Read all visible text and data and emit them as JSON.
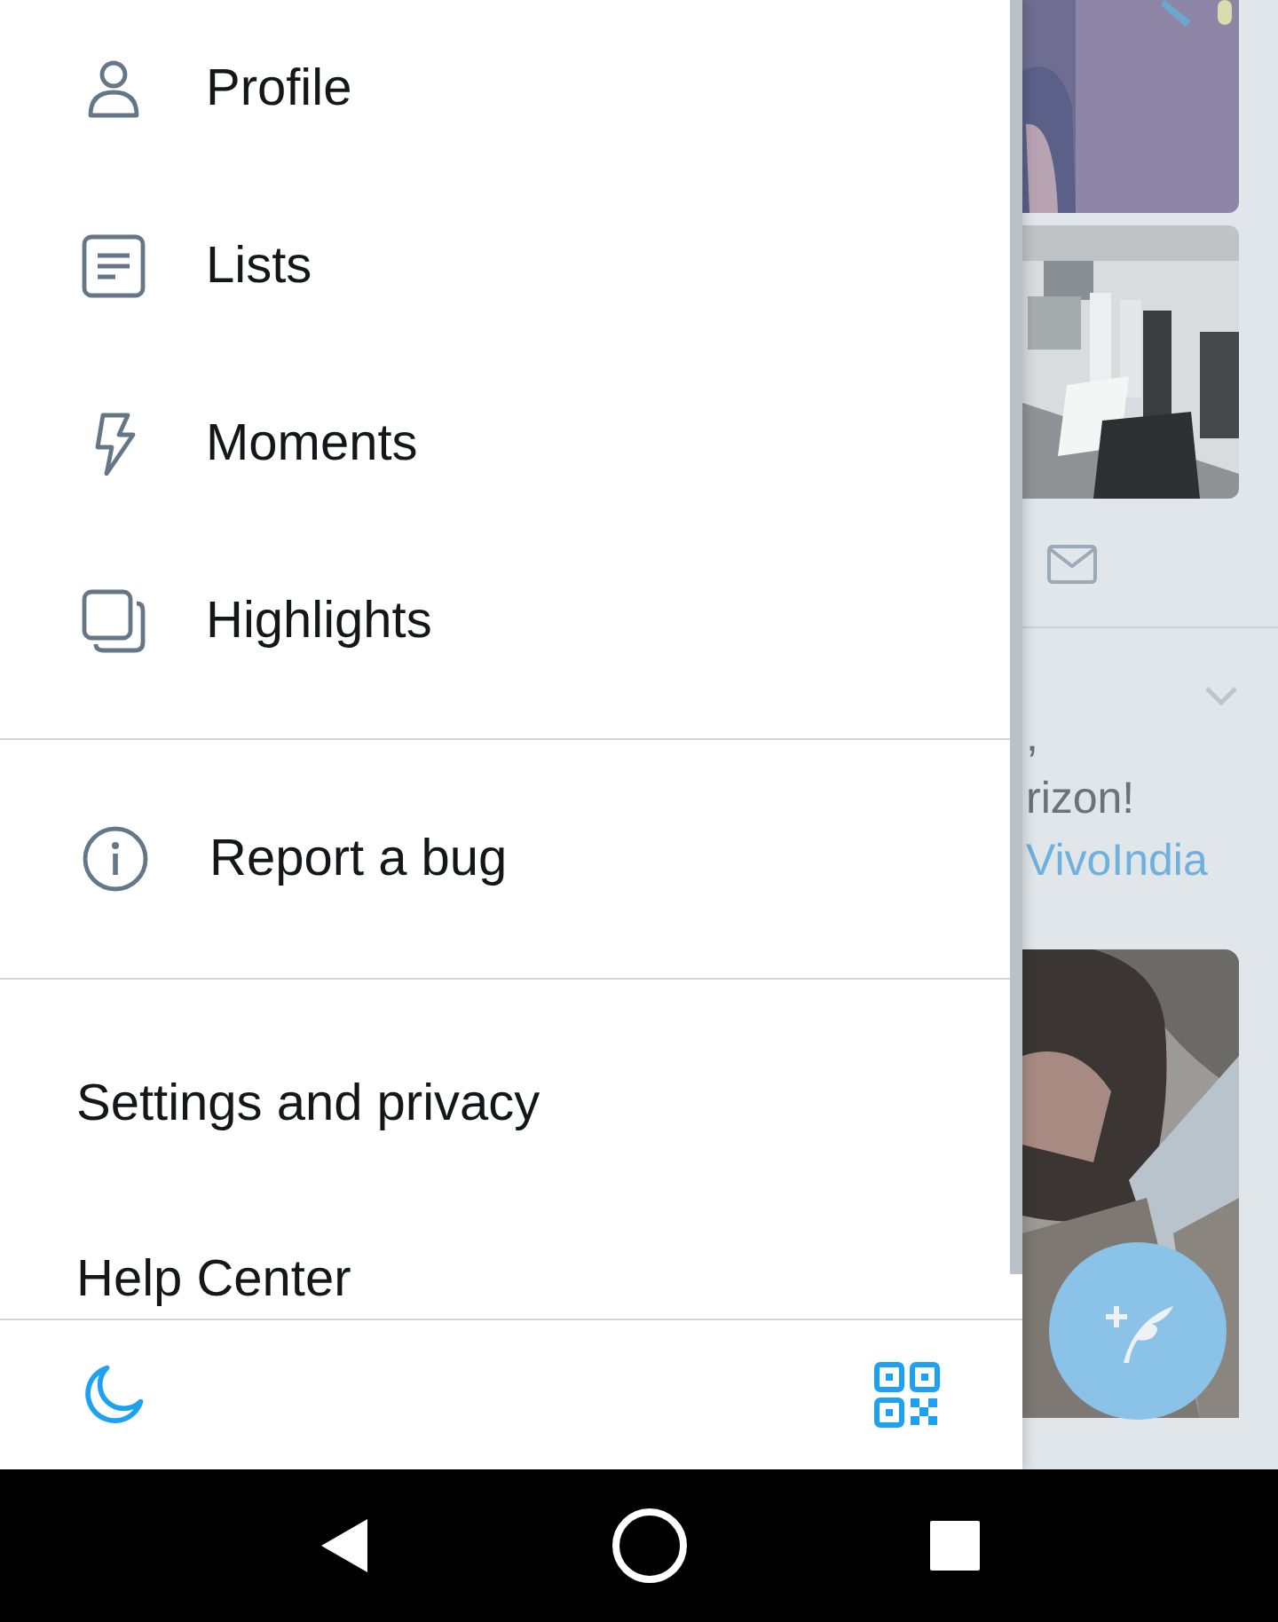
{
  "drawer": {
    "menu": [
      {
        "label": "Profile",
        "kind": "person"
      },
      {
        "label": "Lists",
        "kind": "list"
      },
      {
        "label": "Moments",
        "kind": "bolt"
      },
      {
        "label": "Highlights",
        "kind": "stack"
      }
    ],
    "secondary": [
      {
        "label": "Report a bug",
        "kind": "info"
      }
    ],
    "links": [
      "Settings and privacy",
      "Help Center"
    ]
  },
  "feed": {
    "text_lines": [
      ",",
      "rizon!"
    ],
    "mention": "VivoIndia"
  }
}
